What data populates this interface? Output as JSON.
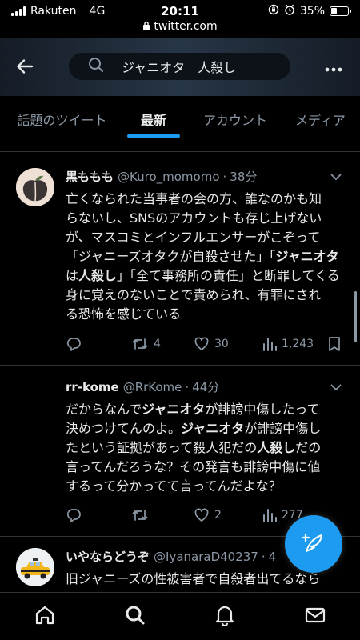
{
  "status_bar": {
    "carrier": "Rakuten",
    "network": "4G",
    "time": "20:11",
    "url": "twitter.com",
    "battery": "35%",
    "battery_level": 0.35
  },
  "search": {
    "query": "ジャニオタ　人殺し"
  },
  "tabs": [
    {
      "label": "話題のツイート",
      "active": false
    },
    {
      "label": "最新",
      "active": true
    },
    {
      "label": "アカウント",
      "active": false
    },
    {
      "label": "メディア",
      "active": false
    }
  ],
  "tweets": [
    {
      "name": "黒ももも",
      "handle": "@Kuro_momomo",
      "time": "38分",
      "lines": [
        [
          {
            "t": "亡くなられた当事者の会の方、誰なのかも知"
          }
        ],
        [
          {
            "t": "らないし、SNSのアカウントも存じ上げない"
          }
        ],
        [
          {
            "t": "が、マスコミとインフルエンサーがこぞって"
          }
        ],
        [
          {
            "t": "「ジャニーズオタクが自殺させた」「"
          },
          {
            "t": "ジャニオタ",
            "b": true
          }
        ],
        [
          {
            "t": "は",
            "b": false
          },
          {
            "t": "人殺し",
            "b": true
          },
          {
            "t": "」「全て事務所の責任」と断罪してくる"
          }
        ],
        [
          {
            "t": "身に覚えのないことで責められ、有罪にされ"
          }
        ],
        [
          {
            "t": "る恐怖を感じている"
          }
        ]
      ],
      "retweets": "4",
      "likes": "30",
      "views": "1,243"
    },
    {
      "name": "rr-kome",
      "handle": "@RrKome",
      "time": "44分",
      "lines": [
        [
          {
            "t": "だからなんで"
          },
          {
            "t": "ジャニオタ",
            "b": true
          },
          {
            "t": "が誹謗中傷したって"
          }
        ],
        [
          {
            "t": "決めつけてんのよ。"
          },
          {
            "t": "ジャニオタ",
            "b": true
          },
          {
            "t": "が誹謗中傷し"
          }
        ],
        [
          {
            "t": "たという証拠があって殺人犯だの"
          },
          {
            "t": "人殺し",
            "b": true
          },
          {
            "t": "だの"
          }
        ],
        [
          {
            "t": "言ってんだろうな？その発言も誹謗中傷に値"
          }
        ],
        [
          {
            "t": "するって分かってて言ってんだよな？"
          }
        ]
      ],
      "retweets": "",
      "likes": "2",
      "views": "277"
    },
    {
      "name": "いやならどうぞ",
      "handle": "@IyanaraD40237",
      "time": "4",
      "lines": [
        [
          {
            "t": "旧ジャニーズの性被害者で自殺者出てるなら"
          }
        ]
      ]
    }
  ]
}
